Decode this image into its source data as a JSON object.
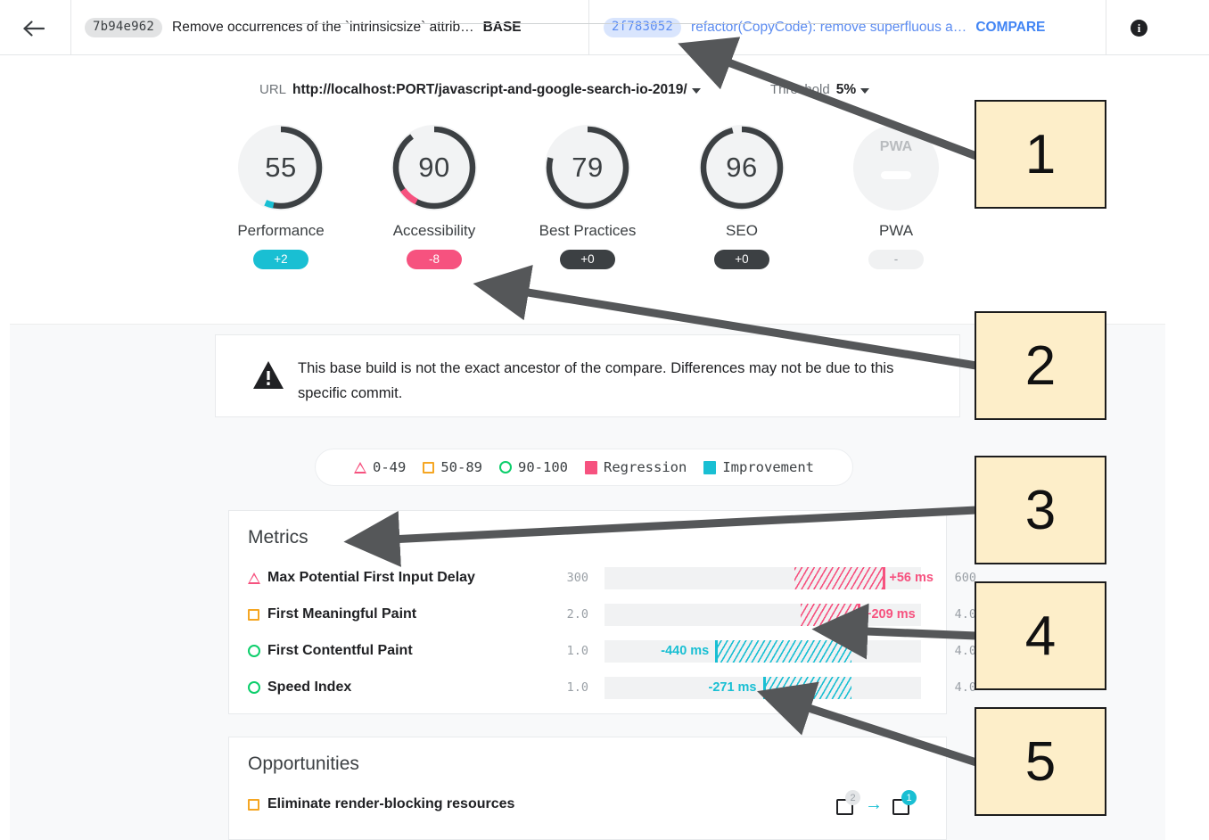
{
  "header": {
    "back_icon": "arrow-left-icon",
    "base": {
      "hash": "7b94e962",
      "title": "Remove occurrences of the `intrinsicsize` attrib…",
      "label": "BASE"
    },
    "compare": {
      "hash": "2f783052",
      "title": "refactor(CopyCode): remove superfluous a…",
      "label": "COMPARE"
    },
    "info_icon": "info-icon"
  },
  "controls": {
    "url_label": "URL",
    "url_value": "http://localhost:PORT/javascript-and-google-search-io-2019/",
    "threshold_label": "Threshold",
    "threshold_value": "5%"
  },
  "gauges": [
    {
      "name": "Performance",
      "score": "55",
      "delta": "+2",
      "delta_kind": "improvement",
      "pct": 55,
      "marker": "improvement",
      "marker_pct": 53
    },
    {
      "name": "Accessibility",
      "score": "90",
      "delta": "-8",
      "delta_kind": "regression",
      "pct": 90,
      "marker": "regression",
      "marker_pct": 90
    },
    {
      "name": "Best Practices",
      "score": "79",
      "delta": "+0",
      "delta_kind": "neutral",
      "pct": 79,
      "marker": "none",
      "marker_pct": 0
    },
    {
      "name": "SEO",
      "score": "96",
      "delta": "+0",
      "delta_kind": "neutral",
      "pct": 96,
      "marker": "none",
      "marker_pct": 0
    },
    {
      "name": "PWA",
      "score": "PWA",
      "delta": "-",
      "delta_kind": "none",
      "pct": 0,
      "marker": "none",
      "marker_pct": 0
    }
  ],
  "warning": {
    "icon": "warning-triangle-icon",
    "text": "This base build is not the exact ancestor of the compare. Differences may not be due to this specific commit."
  },
  "legend": [
    {
      "icon": "triangle-outline-icon",
      "label": "0-49"
    },
    {
      "icon": "square-outline-icon",
      "label": "50-89"
    },
    {
      "icon": "circle-outline-icon",
      "label": "90-100"
    },
    {
      "icon": "swatch-icon",
      "label": "Regression"
    },
    {
      "icon": "swatch-icon",
      "label": "Improvement"
    }
  ],
  "metrics": {
    "title": "Metrics",
    "rows": [
      {
        "icon": "triangle-outline-icon",
        "name": "Max Potential First Input Delay",
        "min": "300",
        "max": "600",
        "value": "+56 ms",
        "kind": "regression",
        "bar_start_pct": 60,
        "bar_end_pct": 88
      },
      {
        "icon": "square-outline-icon",
        "name": "First Meaningful Paint",
        "min": "2.0",
        "max": "4.0",
        "value": "+209 ms",
        "kind": "regression",
        "bar_start_pct": 62,
        "bar_end_pct": 80
      },
      {
        "icon": "circle-outline-icon",
        "name": "First Contentful Paint",
        "min": "1.0",
        "max": "4.0",
        "value": "-440 ms",
        "kind": "improvement",
        "bar_start_pct": 35,
        "bar_end_pct": 78
      },
      {
        "icon": "circle-outline-icon",
        "name": "Speed Index",
        "min": "1.0",
        "max": "4.0",
        "value": "-271 ms",
        "kind": "improvement",
        "bar_start_pct": 50,
        "bar_end_pct": 78
      }
    ]
  },
  "opportunities": {
    "title": "Opportunities",
    "rows": [
      {
        "icon": "square-outline-icon",
        "name": "Eliminate render-blocking resources",
        "base_count": "2",
        "compare_count": "1",
        "arrow": "arrow-right-icon"
      }
    ]
  },
  "annotations": [
    {
      "number": "1"
    },
    {
      "number": "2"
    },
    {
      "number": "3"
    },
    {
      "number": "4"
    },
    {
      "number": "5"
    }
  ],
  "colors": {
    "improvement": "#19bfd3",
    "regression": "#f6527f",
    "neutral": "#3c4043",
    "pass": "#0cce6b",
    "average": "#f5a623",
    "compare_blue": "#4285f4",
    "annotation_fill": "#fdeec9"
  }
}
